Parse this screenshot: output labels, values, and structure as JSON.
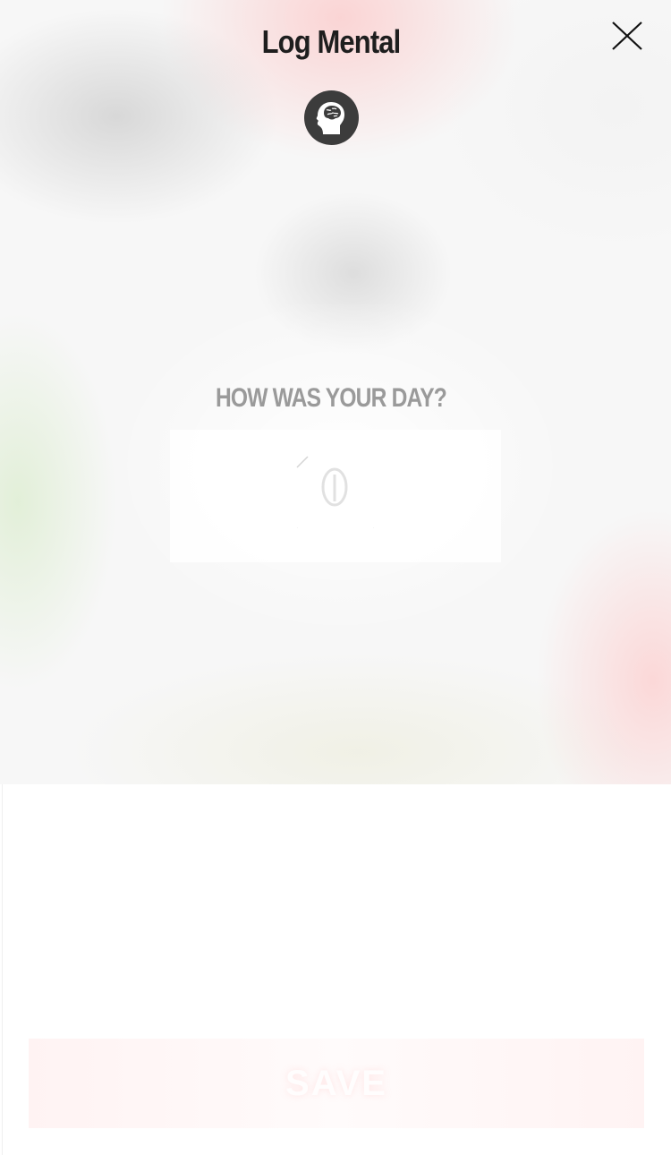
{
  "header": {
    "title": "Log Mental",
    "close_icon": "close-icon",
    "category_icon": "brain-icon"
  },
  "mood": {
    "question": "HOW WAS YOUR DAY?",
    "selected_icon": "neutral-face-icon"
  },
  "save_button": {
    "label": "SAVE"
  },
  "colors": {
    "title": "#1e1e1e",
    "question": "#9a9a9a",
    "icon_circle": "#3c3c3c",
    "accent_pink": "#ffb4b4"
  }
}
